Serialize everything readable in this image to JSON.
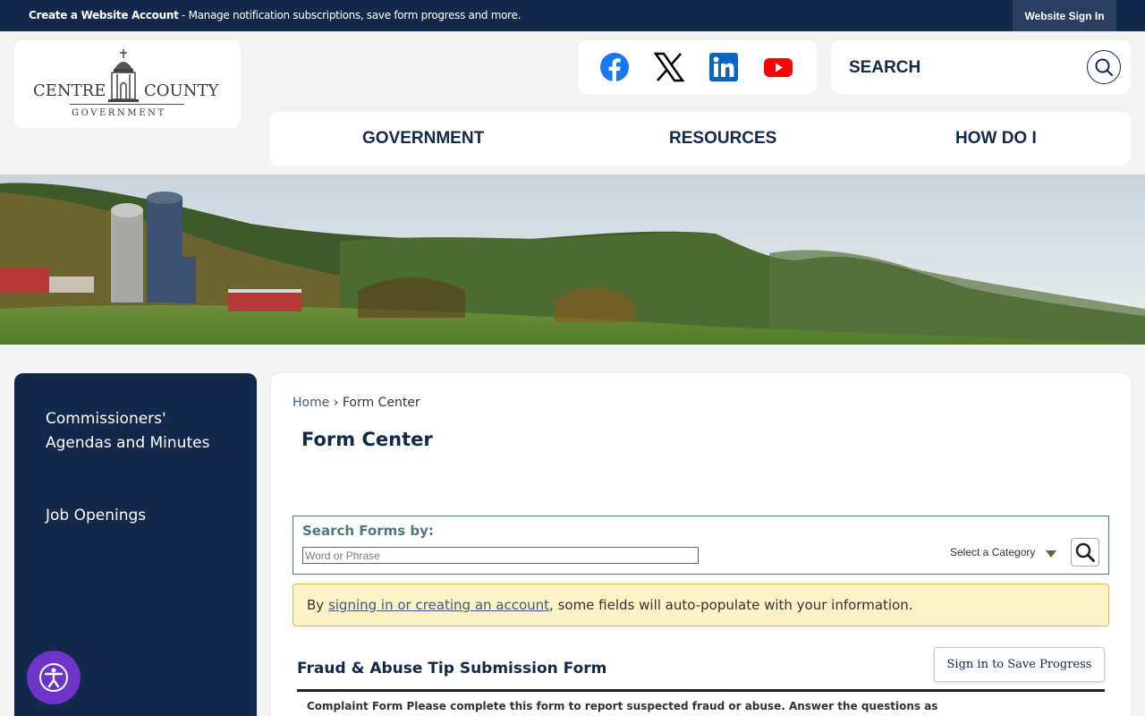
{
  "topbar": {
    "create_account": "Create a Website Account",
    "message": " - Manage notification subscriptions, save form progress and more.",
    "signin": "Website Sign In"
  },
  "logo": {
    "line1": "CENTRE",
    "line2": "COUNTY",
    "line3": "GOVERNMENT"
  },
  "social": [
    {
      "icon": "facebook-icon",
      "color": "#1877f2"
    },
    {
      "icon": "x-icon",
      "color": "#000000"
    },
    {
      "icon": "linkedin-icon",
      "color": "#0a66c2"
    },
    {
      "icon": "youtube-icon",
      "color": "#ff0000"
    }
  ],
  "search": {
    "label": "SEARCH"
  },
  "nav": {
    "items": [
      "GOVERNMENT",
      "RESOURCES",
      "HOW DO I"
    ]
  },
  "sidebar": {
    "items": [
      "Commissioners' Agendas and Minutes",
      "Job Openings"
    ]
  },
  "breadcrumb": {
    "home": "Home",
    "sep": " › ",
    "current": "Form Center"
  },
  "page_title": "Form Center",
  "form_search": {
    "label": "Search Forms by:",
    "placeholder": "Word or Phrase",
    "category": "Select a Category"
  },
  "notice": {
    "prefix": "By ",
    "link": "signing in or creating an account",
    "suffix": ", some fields will auto-populate with your information."
  },
  "form": {
    "title": "Fraud & Abuse Tip Submission Form",
    "save_button": "Sign in to Save Progress",
    "description": "Complaint Form Please complete this form to report suspected fraud or abuse. Answer the questions as"
  },
  "colors": {
    "navy": "#13294b",
    "accessibility": "#6e34c8",
    "notice_bg": "#fbf3c6"
  }
}
